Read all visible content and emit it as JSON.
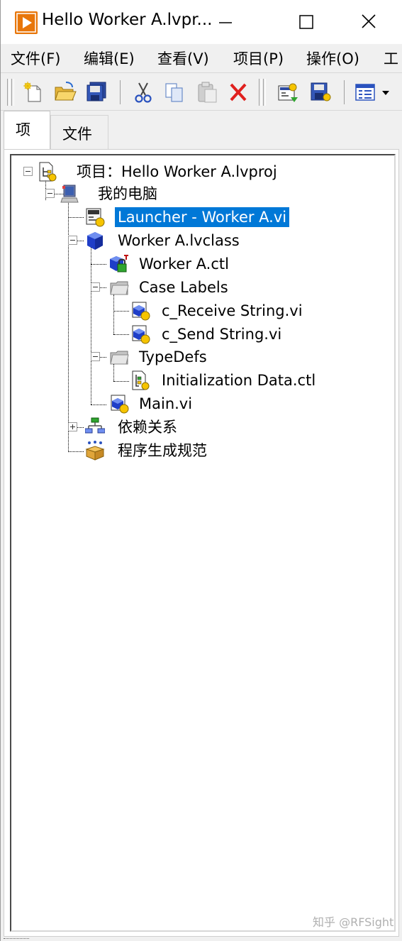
{
  "window": {
    "title": "Hello Worker A.lvpr...",
    "controls": [
      "minimize",
      "maximize",
      "close"
    ]
  },
  "menu": {
    "items": [
      {
        "label": "文件(F)"
      },
      {
        "label": "编辑(E)"
      },
      {
        "label": "查看(V)"
      },
      {
        "label": "项目(P)"
      },
      {
        "label": "操作(O)"
      },
      {
        "label": "工"
      }
    ]
  },
  "toolbar": {
    "buttons": [
      "new-icon",
      "open-icon",
      "save-all-icon",
      "cut-icon",
      "copy-icon",
      "paste-icon",
      "delete-icon",
      "build-icon",
      "save-build-icon",
      "view-options-icon"
    ]
  },
  "tabs": [
    {
      "label": "项",
      "active": true
    },
    {
      "label": "文件",
      "active": false
    }
  ],
  "tree": {
    "project": {
      "label": "项目：Hello Worker A.lvproj",
      "icon": "project-icon"
    },
    "computer": {
      "label": "我的电脑",
      "icon": "computer-icon"
    },
    "items": [
      {
        "label": "Launcher - Worker A.vi",
        "icon": "vi-icon",
        "selected": true
      },
      {
        "label": "Worker A.lvclass",
        "icon": "lvclass-icon"
      },
      {
        "label": "Worker A.ctl",
        "icon": "class-ctl-icon"
      },
      {
        "label": "Case Labels",
        "icon": "folder-icon"
      },
      {
        "label": "c_Receive String.vi",
        "icon": "vi-icon"
      },
      {
        "label": "c_Send String.vi",
        "icon": "vi-icon"
      },
      {
        "label": "TypeDefs",
        "icon": "folder-icon"
      },
      {
        "label": "Initialization Data.ctl",
        "icon": "ctl-icon"
      },
      {
        "label": "Main.vi",
        "icon": "vi-icon"
      },
      {
        "label": "依赖关系",
        "icon": "dependencies-icon"
      },
      {
        "label": "程序生成规范",
        "icon": "build-specs-icon"
      }
    ]
  },
  "colors": {
    "selection": "#0078d7",
    "app_icon": "#e8760a"
  },
  "watermark": "知乎 @RFSight"
}
